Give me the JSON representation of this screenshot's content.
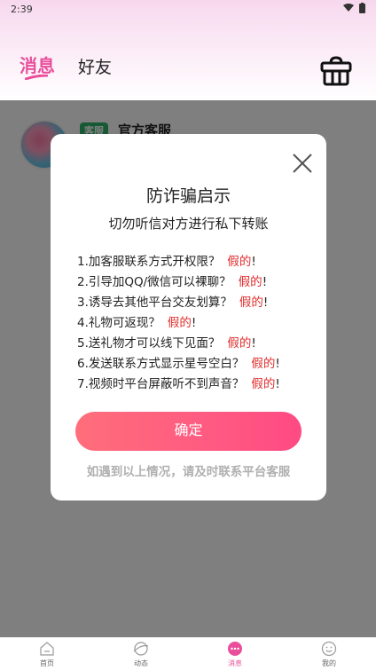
{
  "status_bar": {
    "time": "2:39"
  },
  "header": {
    "tabs": [
      {
        "label": "消息",
        "active": true
      },
      {
        "label": "好友",
        "active": false
      }
    ],
    "accent_color": "#e94e9b"
  },
  "conversations": [
    {
      "badge": "客服",
      "name": "官方客服"
    }
  ],
  "dialog": {
    "title": "防诈骗启示",
    "subtitle": "切勿听信对方进行私下转账",
    "items": [
      {
        "text": "1.加客服联系方式开权限？",
        "false_label": "假的",
        "suffix": "!"
      },
      {
        "text": "2.引导加QQ/微信可以裸聊？",
        "false_label": "假的",
        "suffix": "!"
      },
      {
        "text": "3.诱导去其他平台交友划算？",
        "false_label": "假的",
        "suffix": "!"
      },
      {
        "text": "4.礼物可返现？",
        "false_label": "假的",
        "suffix": "!"
      },
      {
        "text": "5.送礼物才可以线下见面？",
        "false_label": "假的",
        "suffix": "!"
      },
      {
        "text": "6.发送联系方式显示星号空白？",
        "false_label": "假的",
        "suffix": "!"
      },
      {
        "text": "7.视频时平台屏蔽听不到声音？",
        "false_label": "假的",
        "suffix": "!"
      }
    ],
    "confirm_label": "确定",
    "footer": "如遇到以上情况，请及时联系平台客服",
    "false_color": "#e02a2a"
  },
  "bottom_nav": {
    "items": [
      {
        "label": "首页",
        "icon": "home-icon",
        "active": false
      },
      {
        "label": "动态",
        "icon": "planet-icon",
        "active": false
      },
      {
        "label": "消息",
        "icon": "chat-icon",
        "active": true
      },
      {
        "label": "我的",
        "icon": "smile-icon",
        "active": false
      }
    ]
  }
}
